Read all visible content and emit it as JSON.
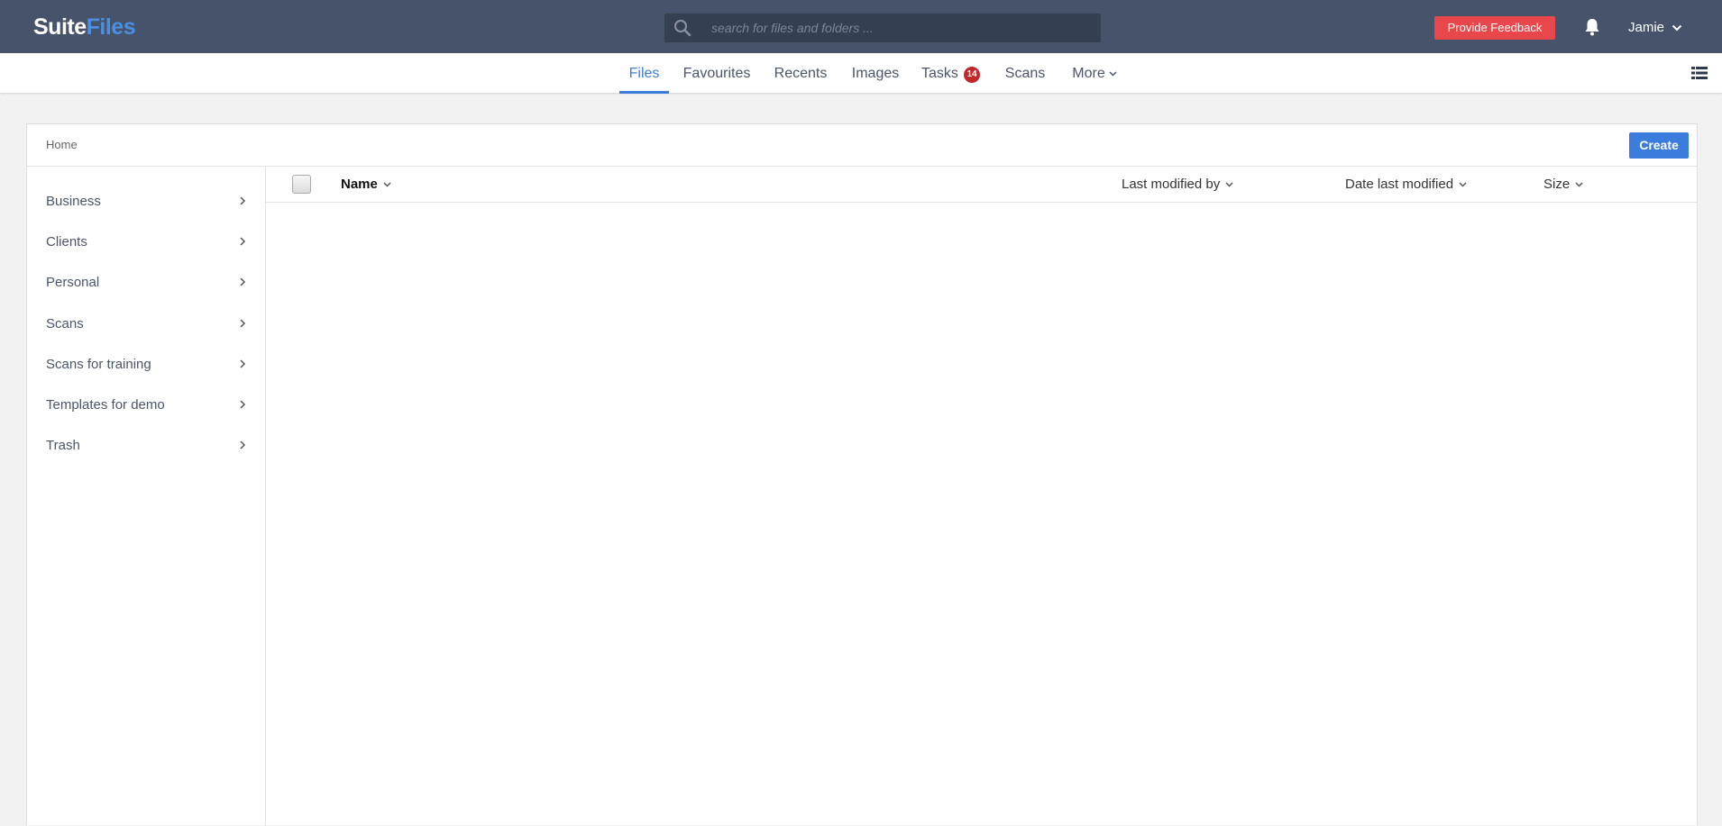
{
  "header": {
    "logo_part1": "Suite",
    "logo_part2": "Files",
    "search_placeholder": "search for files and folders ...",
    "feedback_label": "Provide Feedback",
    "user_name": "Jamie"
  },
  "nav": {
    "tabs": [
      {
        "label": "Files",
        "active": true
      },
      {
        "label": "Favourites"
      },
      {
        "label": "Recents"
      },
      {
        "label": "Images"
      },
      {
        "label": "Tasks",
        "badge": "14"
      },
      {
        "label": "Scans"
      },
      {
        "label": "More"
      }
    ]
  },
  "panel": {
    "breadcrumb": "Home",
    "create_label": "Create"
  },
  "sidebar": {
    "items": [
      {
        "label": "Business"
      },
      {
        "label": "Clients"
      },
      {
        "label": "Personal"
      },
      {
        "label": "Scans"
      },
      {
        "label": "Scans for training"
      },
      {
        "label": "Templates for demo"
      },
      {
        "label": "Trash"
      }
    ]
  },
  "table": {
    "columns": {
      "name": "Name",
      "modified_by": "Last modified by",
      "date_modified": "Date last modified",
      "size": "Size"
    }
  },
  "colors": {
    "header_bg": "#46536a",
    "accent": "#3b7ddd",
    "feedback": "#e8474b",
    "badge": "#c0282b"
  }
}
